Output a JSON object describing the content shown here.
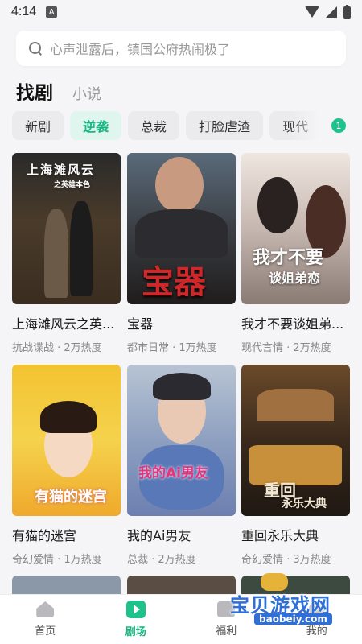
{
  "status_bar": {
    "time": "4:14",
    "notification_badge": "A"
  },
  "search": {
    "placeholder": "心声泄露后，镇国公府热闹极了"
  },
  "title_tabs": {
    "active": "找剧",
    "inactive": "小说"
  },
  "chips": [
    {
      "label": "新剧"
    },
    {
      "label": "逆袭"
    },
    {
      "label": "总裁"
    },
    {
      "label": "打脸虐渣"
    },
    {
      "label": "现代"
    }
  ],
  "chip_badge": "1",
  "dramas": [
    {
      "title": "上海滩风云之英...",
      "meta": "抗战谍战 · 2万热度",
      "poster_text": "上海滩风云",
      "poster_subtext": "之英雄本色"
    },
    {
      "title": "宝器",
      "meta": "都市日常 · 1万热度",
      "poster_text": "宝器",
      "poster_subtext": ""
    },
    {
      "title": "我才不要谈姐弟...",
      "meta": "现代言情 · 2万热度",
      "poster_text": "我才不要",
      "poster_subtext": "谈姐弟恋"
    },
    {
      "title": "有猫的迷宫",
      "meta": "奇幻爱情 · 1万热度",
      "poster_text": "有猫的迷宫",
      "poster_subtext": ""
    },
    {
      "title": "我的Ai男友",
      "meta": "总裁 · 2万热度",
      "poster_text": "我的Ai男友",
      "poster_subtext": ""
    },
    {
      "title": "重回永乐大典",
      "meta": "奇幻爱情 · 3万热度",
      "poster_text": "重回",
      "poster_subtext": "永乐大典"
    }
  ],
  "bottom_nav": [
    {
      "label": "首页",
      "icon": "home-icon"
    },
    {
      "label": "剧场",
      "icon": "play-icon"
    },
    {
      "label": "福利",
      "icon": "gift-icon"
    },
    {
      "label": "我的",
      "icon": "user-icon"
    }
  ],
  "watermark": {
    "text": "宝贝游戏网",
    "url": "baobeiy.com"
  },
  "colors": {
    "accent": "#1ec28b",
    "accent_text": "#16b581",
    "background": "#f5f5f7"
  }
}
